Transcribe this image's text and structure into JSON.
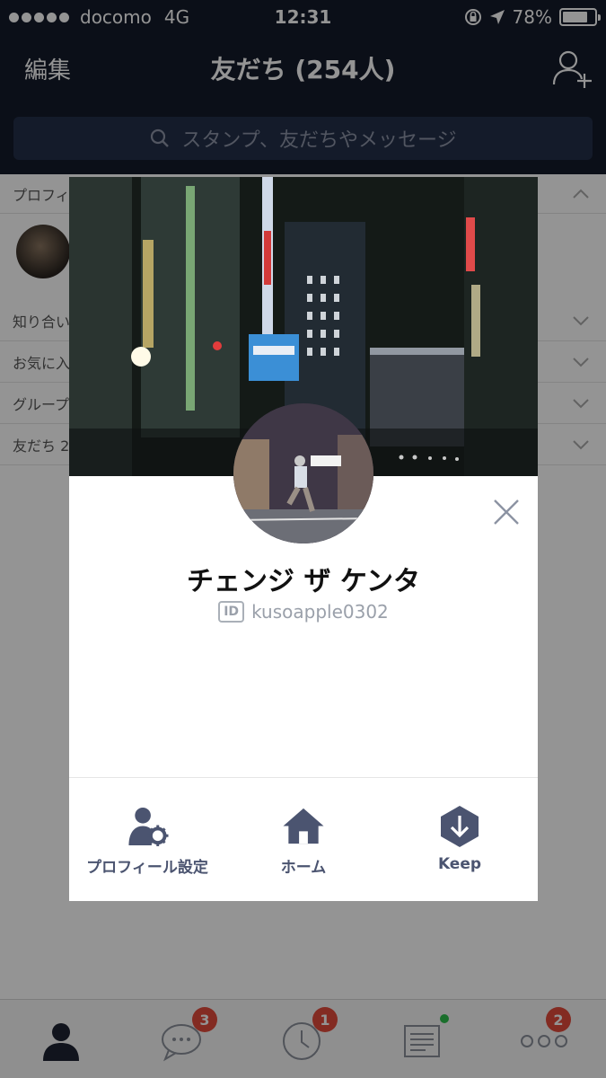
{
  "status_bar": {
    "carrier": "docomo",
    "network": "4G",
    "time": "12:31",
    "battery_percent": "78%",
    "battery_level": 0.78
  },
  "header": {
    "edit_label": "編集",
    "title": "友だち (254人)",
    "search_placeholder": "スタンプ、友だちやメッセージ"
  },
  "friend_list": {
    "sections": [
      {
        "label": "プロフィ"
      },
      {
        "label": "知り合い"
      },
      {
        "label": "お気に入"
      },
      {
        "label": "グループ"
      },
      {
        "label": "友だち 2"
      }
    ]
  },
  "profile": {
    "name": "チェンジ ザ ケンタ",
    "id_tag": "ID",
    "user_id": "kusoapple0302",
    "actions": [
      {
        "label": "プロフィール設定",
        "icon": "profile-settings-icon"
      },
      {
        "label": "ホーム",
        "icon": "home-icon"
      },
      {
        "label": "Keep",
        "icon": "keep-icon"
      }
    ]
  },
  "tab_bar": {
    "tabs": [
      {
        "icon": "friends-icon",
        "badge": ""
      },
      {
        "icon": "chats-icon",
        "badge": "3"
      },
      {
        "icon": "timeline-icon",
        "badge": "1"
      },
      {
        "icon": "news-icon",
        "badge": ""
      },
      {
        "icon": "more-icon",
        "badge": "2"
      }
    ]
  },
  "colors": {
    "header_bg": "#141a2a",
    "accent": "#4b5470",
    "badge": "#e24b3b",
    "news_dot": "#2dbf4d"
  }
}
